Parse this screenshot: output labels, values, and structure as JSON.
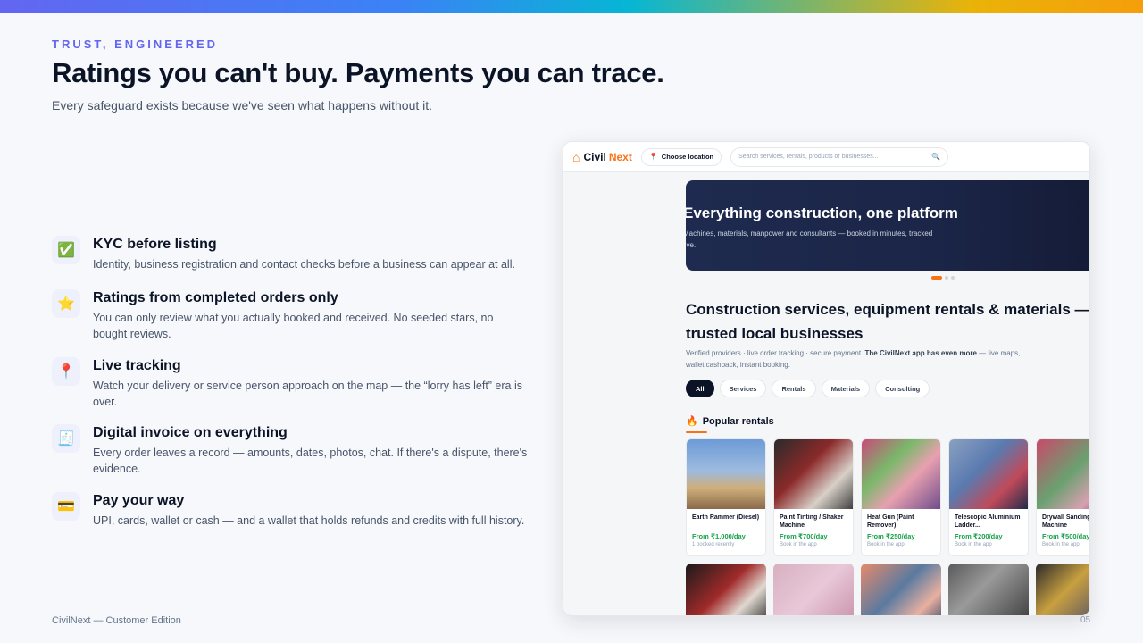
{
  "slide": {
    "eyebrow": "TRUST, ENGINEERED",
    "title": "Ratings you can't buy. Payments you can trace.",
    "subtitle": "Every safeguard exists because we've seen what happens without it.",
    "footer_left": "CivilNext — Customer Edition",
    "page_number": "05"
  },
  "features": [
    {
      "icon": "check-box-icon",
      "glyph": "✅",
      "title": "KYC before listing",
      "desc": "Identity, business registration and contact checks before a business can appear at all."
    },
    {
      "icon": "star-icon",
      "glyph": "⭐",
      "title": "Ratings from completed orders only",
      "desc": "You can only review what you actually booked and received. No seeded stars, no bought reviews."
    },
    {
      "icon": "map-pin-icon",
      "glyph": "📍",
      "title": "Live tracking",
      "desc": "Watch your delivery or service person approach on the map — the “lorry has left” era is over."
    },
    {
      "icon": "receipt-icon",
      "glyph": "🧾",
      "title": "Digital invoice on everything",
      "desc": "Every order leaves a record — amounts, dates, photos, chat. If there's a dispute, there's evidence."
    },
    {
      "icon": "credit-card-icon",
      "glyph": "💳",
      "title": "Pay your way",
      "desc": "UPI, cards, wallet or cash — and a wallet that holds refunds and credits with full history."
    }
  ],
  "app": {
    "logo_part1": "Civil",
    "logo_part2": "Next",
    "location_label": "Choose location",
    "search_placeholder": "Search services, rentals, products or businesses...",
    "hero_title": "Everything construction, one platform",
    "hero_subtitle": "Machines, materials, manpower and consultants — booked in minutes, tracked live.",
    "headline": "Construction services, equipment rentals & materials — de",
    "headline_line2": "trusted local businesses",
    "desc_plain": "Verified providers · live order tracking · secure payment. ",
    "desc_bold": "The CivilNext app has even more",
    "desc_tail": " — live maps, wallet cashback, instant booking.",
    "chips": [
      "All",
      "Services",
      "Rentals",
      "Materials",
      "Consulting"
    ],
    "popular_title": "Popular rentals",
    "cards": [
      {
        "name": "Earth Rammer (Diesel)",
        "price": "From ₹1,000/day",
        "note": "1 booked recently"
      },
      {
        "name": "Paint Tinting / Shaker Machine",
        "price": "From ₹700/day",
        "note": "Book in the app"
      },
      {
        "name": "Heat Gun (Paint Remover)",
        "price": "From ₹250/day",
        "note": "Book in the app"
      },
      {
        "name": "Telescopic Aluminium Ladder...",
        "price": "From ₹200/day",
        "note": "Book in the app"
      },
      {
        "name": "Drywall Sanding Machine",
        "price": "From ₹500/day",
        "note": "Book in the app"
      }
    ]
  },
  "colors": {
    "accent": "#6366f1",
    "brand_orange": "#f97316",
    "price_green": "#16a34a",
    "hero_navy": "#1e2a4f"
  }
}
